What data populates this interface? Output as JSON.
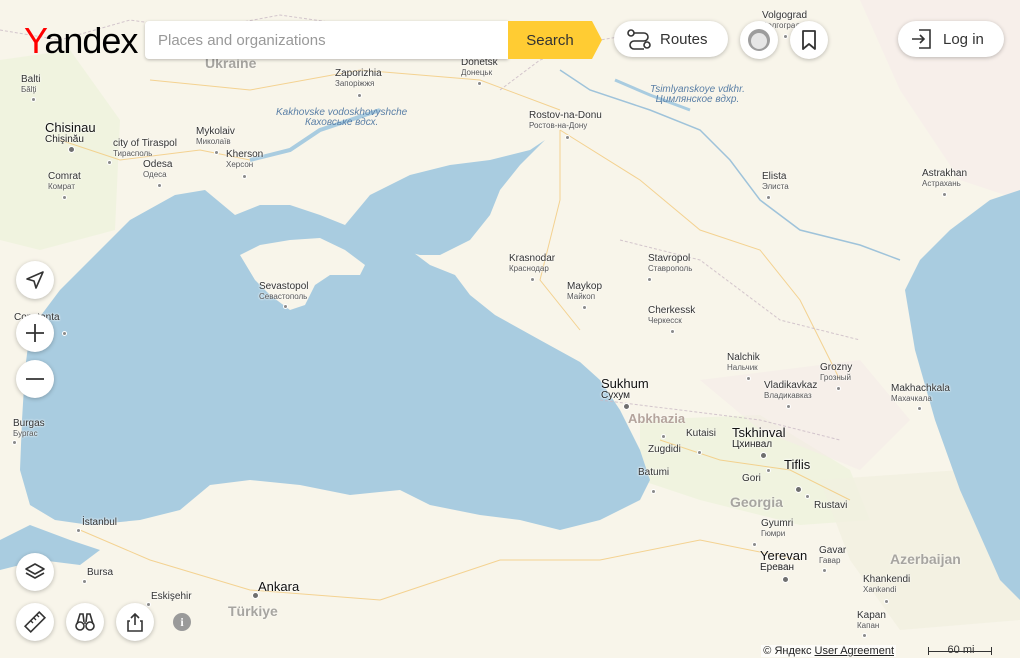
{
  "header": {
    "logo_text": "Yandex",
    "search_placeholder": "Places and organizations",
    "search_button": "Search",
    "routes_label": "Routes",
    "login_label": "Log in",
    "brand_color": "#ffcc33"
  },
  "map": {
    "regions": [
      "Ukraine",
      "Abkhazia",
      "Georgia",
      "Azerbaijan",
      "Türkiye"
    ],
    "water": {
      "kakhovske": "Kakhovske vodoskhovyshche",
      "kakhovske_ru": "Каховське вдсх.",
      "tsimlyansk": "Tsimlyanskoye vdkhr.",
      "tsimlyansk_ru": "Цимлянское вдхр."
    },
    "cities": {
      "volgograd": "Volgograd",
      "volgograd_ru": "Волгоград",
      "balti": "Balti",
      "balti_ru": "Бălţi",
      "chisinau": "Chisinau",
      "chisinau_ru": "Chişinău",
      "zaporizhia": "Zaporizhia",
      "zaporizhia_ru": "Запоріжжя",
      "donetsk": "Donetsk",
      "donetsk_ru": "Донецьк",
      "rostov": "Rostov-na-Donu",
      "rostov_ru": "Ростов-на-Дону",
      "mykolaiv": "Mykolaiv",
      "mykolaiv_ru": "Миколаїв",
      "tiraspol": "city of Tiraspol",
      "tiraspol_ru": "Тирасполь",
      "kherson": "Kherson",
      "kherson_ru": "Херсон",
      "odesa": "Odesa",
      "odesa_ru": "Одеса",
      "comrat": "Comrat",
      "comrat_ru": "Комрат",
      "elista": "Elista",
      "elista_ru": "Элиста",
      "astrakhan": "Astrakhan",
      "astrakhan_ru": "Астрахань",
      "krasnodar": "Krasnodar",
      "krasnodar_ru": "Краснодар",
      "stavropol": "Stavropol",
      "stavropol_ru": "Ставрополь",
      "maykop": "Maykop",
      "maykop_ru": "Майкоп",
      "sevastopol": "Sevastopol",
      "sevastopol_ru": "Севастополь",
      "cherkessk": "Cherkessk",
      "cherkessk_ru": "Черкесск",
      "nalchik": "Nalchik",
      "nalchik_ru": "Нальчик",
      "grozny": "Grozny",
      "grozny_ru": "Грозный",
      "vladikavkaz": "Vladikavkaz",
      "vladikavkaz_ru": "Владикавказ",
      "makhachkala": "Makhachkala",
      "makhachkala_ru": "Махачкала",
      "sukhum": "Sukhum",
      "sukhum_ru": "Сухум",
      "kutaisi": "Kutaisi",
      "tskhinval": "Tskhinval",
      "tskhinval_ru": "Цхинвал",
      "zugdidi": "Zugdidi",
      "tiflis": "Tiflis",
      "gori": "Gori",
      "batumi": "Batumi",
      "rustavi": "Rustavi",
      "gyumri": "Gyumri",
      "gyumri_ru": "Гюмри",
      "yerevan": "Yerevan",
      "yerevan_ru": "Ереван",
      "gavar": "Gavar",
      "gavar_ru": "Гавар",
      "khankendi": "Khankendi",
      "khankendi_ru": "Xankəndi",
      "kapan": "Kapan",
      "kapan_ru": "Капан",
      "burgas": "Burgas",
      "burgas_ru": "Бургас",
      "constanta": "Constanta",
      "istanbul": "İstanbul",
      "bursa": "Bursa",
      "eskisehir": "Eskişehir",
      "ankara": "Ankara"
    }
  },
  "footer": {
    "copyright": "© Яндекс",
    "agreement": "User Agreement",
    "scale": "60 mi"
  }
}
